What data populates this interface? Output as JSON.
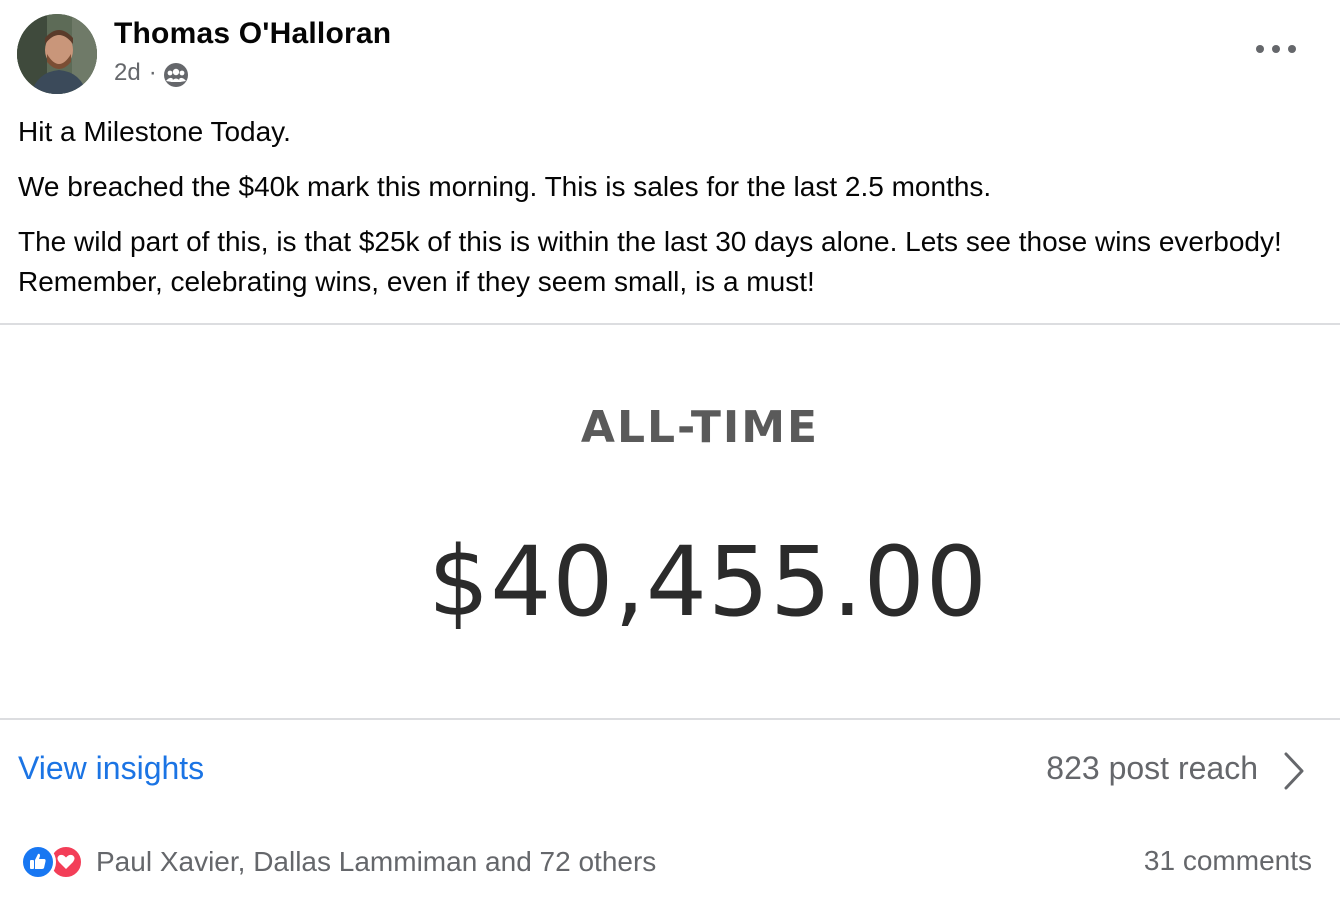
{
  "post": {
    "author": "Thomas O'Halloran",
    "time": "2d",
    "separator": "·",
    "audience_icon": "group-icon",
    "more_icon": "more-options-icon",
    "paragraphs": [
      "Hit a Milestone Today.",
      "We breached the $40k mark this morning. This is sales for the last 2.5 months.",
      "The wild part of this, is that $25k of this is within the last 30 days alone. Lets see those wins everbody! Remember, celebrating wins, even if they seem small, is a must!"
    ]
  },
  "image": {
    "label": "ALL-TIME",
    "amount": "$40,455.00"
  },
  "insights": {
    "link": "View insights",
    "reach": "823 post reach"
  },
  "reactions": {
    "icons": [
      "like-icon",
      "love-icon"
    ],
    "names": "Paul Xavier, Dallas Lammiman and 72 others",
    "comments": "31 comments"
  },
  "colors": {
    "link": "#1b74e4",
    "secondary_text": "#65676b",
    "like": "#1877f2",
    "love": "#f33e58"
  }
}
